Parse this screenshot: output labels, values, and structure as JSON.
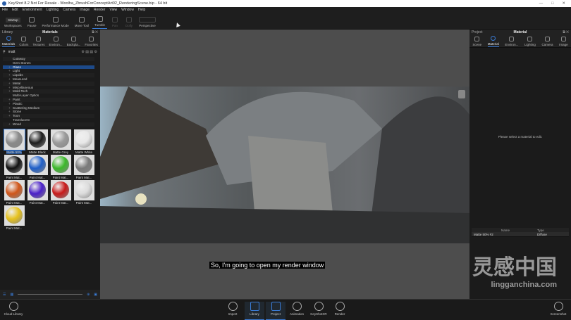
{
  "window": {
    "title": "KeyShot 8.2 Not For Resale  -  Woolha_ZbrushForConceptArt02_RenderingScene.bip  - 64 bit",
    "controls": [
      "—",
      "□",
      "✕"
    ]
  },
  "menu": [
    "File",
    "Edit",
    "Environment",
    "Lighting",
    "Camera",
    "Image",
    "Render",
    "View",
    "Window",
    "Help"
  ],
  "toolbar": [
    {
      "label": "Workspaces",
      "value": "Startup"
    },
    {
      "label": "Pause"
    },
    {
      "label": "Performance Mode"
    },
    {
      "label": "Move Tool"
    },
    {
      "label": "Tumble"
    },
    {
      "label": "Pan"
    },
    {
      "label": "Dolly"
    },
    {
      "label": "Perspective"
    }
  ],
  "library": {
    "title": "Library",
    "header": "Materials",
    "tabs": [
      "Materials",
      "Colors",
      "Textures",
      "Environ...",
      "Backpla...",
      "Favorites"
    ],
    "search": "matt",
    "tree": [
      {
        "l": "Cutaway",
        "e": false
      },
      {
        "l": "Gem Stones",
        "e": false
      },
      {
        "l": "Glass",
        "e": true,
        "sel": true
      },
      {
        "l": "Light",
        "e": true
      },
      {
        "l": "Liquids",
        "e": true
      },
      {
        "l": "Measured",
        "e": true
      },
      {
        "l": "Metal",
        "e": true
      },
      {
        "l": "Miscellaneous",
        "e": true
      },
      {
        "l": "Mold-Tech",
        "e": true
      },
      {
        "l": "Multi-Layer Optics",
        "e": false
      },
      {
        "l": "Paint",
        "e": true
      },
      {
        "l": "Plastic",
        "e": true
      },
      {
        "l": "Scattering Medium",
        "e": true
      },
      {
        "l": "Stone",
        "e": true
      },
      {
        "l": "Toon",
        "e": true
      },
      {
        "l": "Translucent",
        "e": false
      },
      {
        "l": "Wood",
        "e": true
      }
    ],
    "materials": [
      {
        "name": "Matte 50%",
        "color": "#8a8a8a",
        "sel": true
      },
      {
        "name": "Matte Black",
        "color": "#1c1c1c"
      },
      {
        "name": "Matte Grey",
        "color": "#9a9a9a"
      },
      {
        "name": "Matte White",
        "color": "#e8e8e8"
      },
      {
        "name": "Paint Mat...",
        "color": "#111111"
      },
      {
        "name": "Paint Mat...",
        "color": "#1f5fc8"
      },
      {
        "name": "Paint Mat...",
        "color": "#3cb82a"
      },
      {
        "name": "Paint Mat...",
        "color": "#7a7a7a"
      },
      {
        "name": "Paint Mat...",
        "color": "#d0561a"
      },
      {
        "name": "Paint Mat...",
        "color": "#4a20c8"
      },
      {
        "name": "Paint Mat...",
        "color": "#c81a1a"
      },
      {
        "name": "Paint Mat...",
        "color": "#dcdcdc"
      },
      {
        "name": "Paint Mat...",
        "color": "#e6c21e"
      }
    ]
  },
  "project": {
    "title": "Project",
    "header": "Material",
    "tabs": [
      "Scene",
      "Material",
      "Environ...",
      "Lighting",
      "Camera",
      "Image"
    ],
    "message": "Please select a material to edit.",
    "columns": [
      "Name",
      "Type"
    ],
    "rows": [
      [
        "Matte 50% #2",
        "Diffuse"
      ]
    ]
  },
  "subtitle": "So, I'm going to open my render window",
  "bottom": {
    "cloud": "Cloud Library",
    "buttons": [
      "Import",
      "Library",
      "Project",
      "Animation",
      "KeyShotXR",
      "Render"
    ],
    "screenshot": "Screenshot"
  },
  "watermark": {
    "big": "灵感中国",
    "small": "lingganchina.com"
  },
  "accent": "#3a7bd5"
}
